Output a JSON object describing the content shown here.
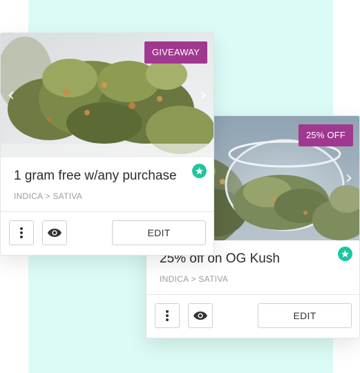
{
  "cards": [
    {
      "badge": "GIVEAWAY",
      "title": "1 gram free w/any purchase",
      "category": "INDICA > SATIVA",
      "edit_label": "EDIT",
      "image": "cannabis-buds-photo"
    },
    {
      "badge": "25% OFF",
      "title": "25% off on OG Kush",
      "category": "INDICA > SATIVA",
      "edit_label": "EDIT",
      "image": "cannabis-jar-photo"
    }
  ],
  "icons": {
    "more": "kebab-icon",
    "view": "eye-icon",
    "featured": "star-icon",
    "next": "chevron-right-icon",
    "prev": "chevron-left-icon"
  },
  "colors": {
    "badge": "#a0388f",
    "star": "#1ec6a0",
    "background_panel": "#dcfbf6"
  }
}
